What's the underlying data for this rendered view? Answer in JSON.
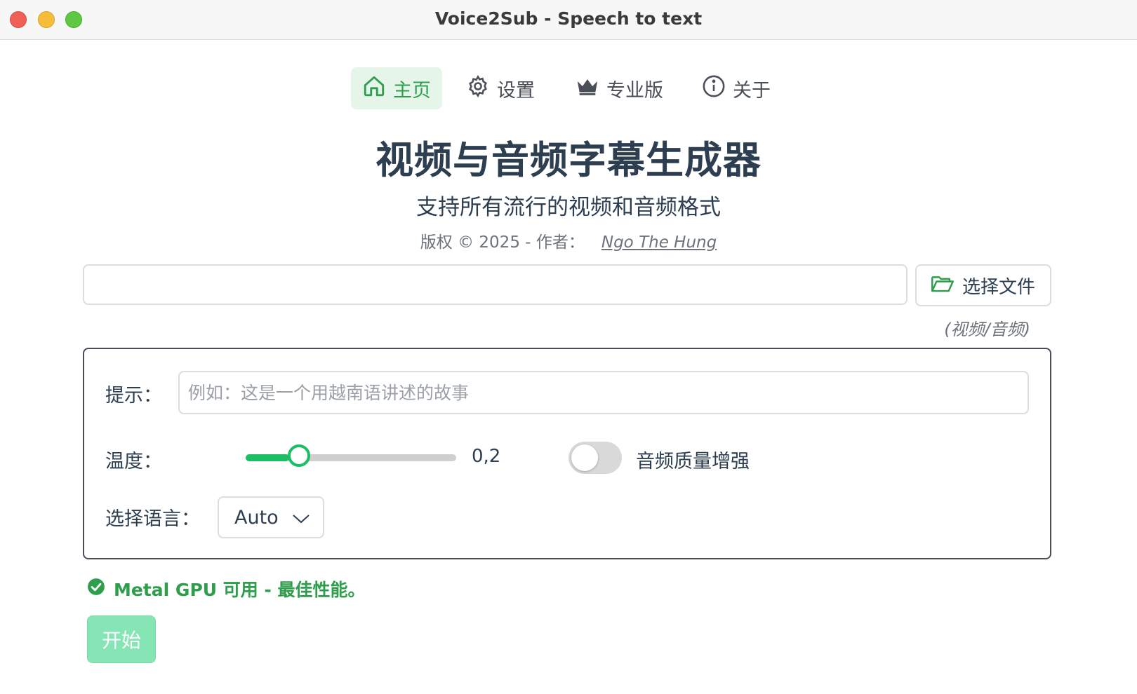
{
  "window": {
    "title": "Voice2Sub - Speech to text"
  },
  "nav": {
    "home": "主页",
    "settings": "设置",
    "pro": "专业版",
    "about": "关于"
  },
  "header": {
    "title": "视频与音频字幕生成器",
    "subtitle": "支持所有流行的视频和音频格式",
    "copyright": "版权 © 2025 - 作者：",
    "author": "Ngo The Hung"
  },
  "file": {
    "path_value": "",
    "choose_label": "选择文件",
    "hint": "(视频/音频)"
  },
  "options": {
    "prompt_label": "提示：",
    "prompt_placeholder": "例如：这是一个用越南语讲述的故事",
    "temperature_label": "温度：",
    "temperature_value": "0,2",
    "temperature_fraction": 0.2,
    "enhance_label": "音频质量增强",
    "enhance_on": false,
    "language_label": "选择语言：",
    "language_value": "Auto"
  },
  "status": {
    "text": "Metal GPU 可用 - 最佳性能。"
  },
  "actions": {
    "start_label": "开始"
  },
  "colors": {
    "accent": "#2e9e4c",
    "slider": "#1bbe62",
    "start_disabled": "#86e5b4"
  }
}
